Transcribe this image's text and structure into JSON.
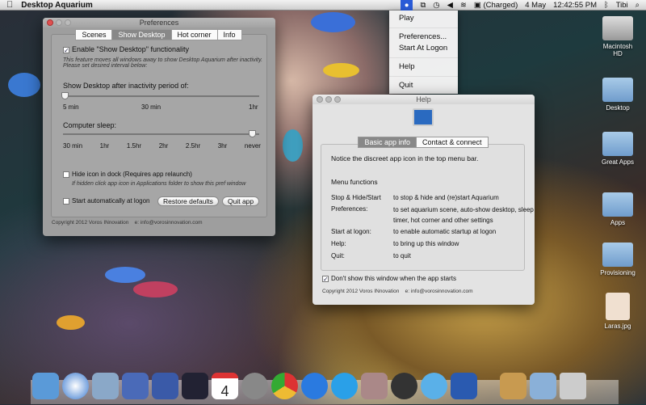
{
  "menubar": {
    "app_name": "Desktop Aquarium",
    "battery": "(Charged)",
    "date": "4 May",
    "time": "12:42:55 PM",
    "user": "Tibi"
  },
  "dropdown": {
    "items": [
      "Play",
      "Preferences...",
      "Start At Logon",
      "Help",
      "Quit"
    ]
  },
  "prefs": {
    "title": "Preferences",
    "tabs": [
      "Scenes",
      "Show Desktop",
      "Hot corner",
      "Info"
    ],
    "selected_tab": "Show Desktop",
    "enable_label": "Enable \"Show Desktop\" functionality",
    "enable_checked": true,
    "note": "This feature moves all windows away to show Desktop Aquarium after inactivity. Please set desired interval below:",
    "inactivity_label": "Show Desktop after inactivity period of:",
    "inactivity_ticks": [
      "5 min",
      "30 min",
      "1hr"
    ],
    "inactivity_value": "5 min",
    "sleep_label": "Computer sleep:",
    "sleep_ticks": [
      "30 min",
      "1hr",
      "1.5hr",
      "2hr",
      "2.5hr",
      "3hr",
      "never"
    ],
    "sleep_value": "never",
    "hide_icon_label": "Hide icon in dock (Requires app relaunch)",
    "hide_icon_note": "If hidden click app icon in Applications folder to show this pref window",
    "start_auto_label": "Start automatically at logon",
    "restore_label": "Restore defaults",
    "quit_label": "Quit app",
    "copyright": "Copyright 2012 Voros INnovation",
    "email": "e: info@vorosinnovation.com"
  },
  "help": {
    "title": "Help",
    "tabs": [
      "Basic app info",
      "Contact & connect"
    ],
    "notice": "Notice the discreet app icon in the top menu bar.",
    "menu_heading": "Menu functions",
    "rows": [
      {
        "k": "Stop & Hide/Start",
        "v": "to stop & hide and (re)start Aquarium"
      },
      {
        "k": "Preferences:",
        "v": "to set aquarium scene, auto-show desktop, sleep timer, hot corner and other settings"
      },
      {
        "k": "Start at logon:",
        "v": "to enable automatic startup at logon"
      },
      {
        "k": "Help:",
        "v": "to bring up this window"
      },
      {
        "k": "Quit:",
        "v": "to quit"
      }
    ],
    "dont_show_label": "Don't show this window when the app starts",
    "copyright": "Copyright 2012 Voros INnovation",
    "email": "e: info@vorosinnovation.com"
  },
  "desktop_icons": [
    "Macintosh HD",
    "Desktop",
    "Great Apps",
    "Apps",
    "Provisioning",
    "Laras.jpg"
  ],
  "dock": {
    "calendar_day": "4"
  }
}
